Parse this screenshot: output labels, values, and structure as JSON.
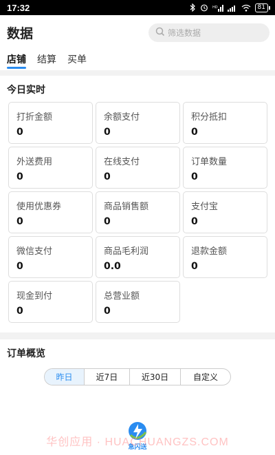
{
  "status_bar": {
    "time": "17:32",
    "battery": "81"
  },
  "header": {
    "title": "数据",
    "search_placeholder": "筛选数据"
  },
  "tabs": [
    {
      "label": "店铺",
      "active": true
    },
    {
      "label": "结算",
      "active": false
    },
    {
      "label": "买单",
      "active": false
    }
  ],
  "today": {
    "title": "今日实时",
    "cards": [
      {
        "label": "打折金额",
        "value": "0"
      },
      {
        "label": "余额支付",
        "value": "0"
      },
      {
        "label": "积分抵扣",
        "value": "0"
      },
      {
        "label": "外送费用",
        "value": "0"
      },
      {
        "label": "在线支付",
        "value": "0"
      },
      {
        "label": "订单数量",
        "value": "0"
      },
      {
        "label": "使用优惠券",
        "value": "0"
      },
      {
        "label": "商品销售额",
        "value": "0"
      },
      {
        "label": "支付宝",
        "value": "0"
      },
      {
        "label": "微信支付",
        "value": "0"
      },
      {
        "label": "商品毛利润",
        "value": "0.0"
      },
      {
        "label": "退款金额",
        "value": "0"
      },
      {
        "label": "现金到付",
        "value": "0"
      },
      {
        "label": "总营业额",
        "value": "0"
      }
    ]
  },
  "overview": {
    "title": "订单概览",
    "ranges": [
      {
        "label": "昨日",
        "active": true
      },
      {
        "label": "近7日",
        "active": false
      },
      {
        "label": "近30日",
        "active": false
      },
      {
        "label": "自定义",
        "active": false
      }
    ]
  },
  "footer": {
    "logo_text": "急闪送",
    "watermark": "华创应用 · HUACHUANGZS.COM"
  },
  "colors": {
    "accent": "#2a8cf0",
    "card_border": "#dddddd",
    "section_gap": "#f2f2f2"
  }
}
